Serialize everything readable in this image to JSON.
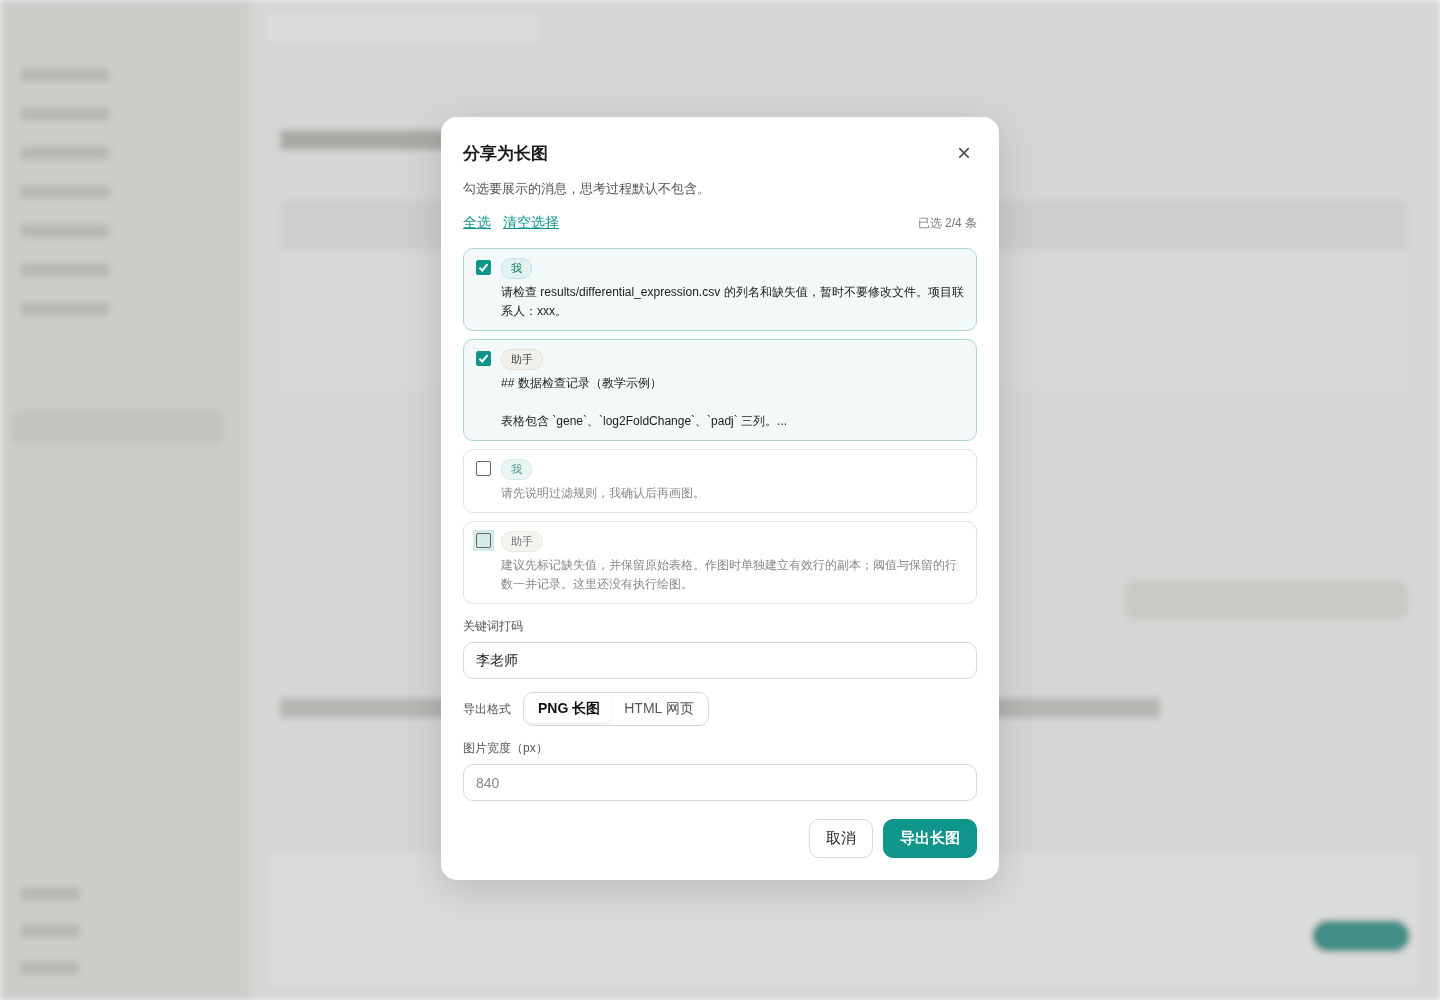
{
  "dialog": {
    "title": "分享为长图",
    "close": "×",
    "hint": "勾选要展示的消息，思考过程默认不包含。",
    "links": [
      "全选",
      "清空选择"
    ],
    "count": "已选 2/4 条",
    "messages": [
      {
        "kind": "user",
        "badge": "我",
        "checked": true,
        "focused": false,
        "text": "请检查 results/differential_expression.csv 的列名和缺失值，暂时不要修改文件。项目联系人：xxx。"
      },
      {
        "kind": "assistant",
        "badge": "助手",
        "checked": true,
        "focused": false,
        "text": "## 数据检查记录（教学示例）",
        "text_2": "表格包含 `gene`、`log2FoldChange`、`padj` 三列。..."
      },
      {
        "kind": "user",
        "badge": "我",
        "checked": false,
        "focused": false,
        "text": "请先说明过滤规则，我确认后再画图。"
      },
      {
        "kind": "assistant",
        "badge": "助手",
        "checked": false,
        "focused": true,
        "text": "建议先标记缺失值，并保留原始表格。作图时单独建立有效行的副本；阈值与保留的行数一并记录。这里还没有执行绘图。"
      }
    ],
    "mask": {
      "label": "关键词打码",
      "value": "李老师"
    },
    "format": {
      "label": "导出格式",
      "options": [
        {
          "label": "PNG 长图",
          "selected": true
        },
        {
          "label": "HTML 网页",
          "selected": false
        }
      ]
    },
    "width": {
      "label": "图片宽度（px）",
      "placeholder": "840"
    },
    "buttons": {
      "cancel": "取消",
      "export": "导出长图"
    }
  }
}
